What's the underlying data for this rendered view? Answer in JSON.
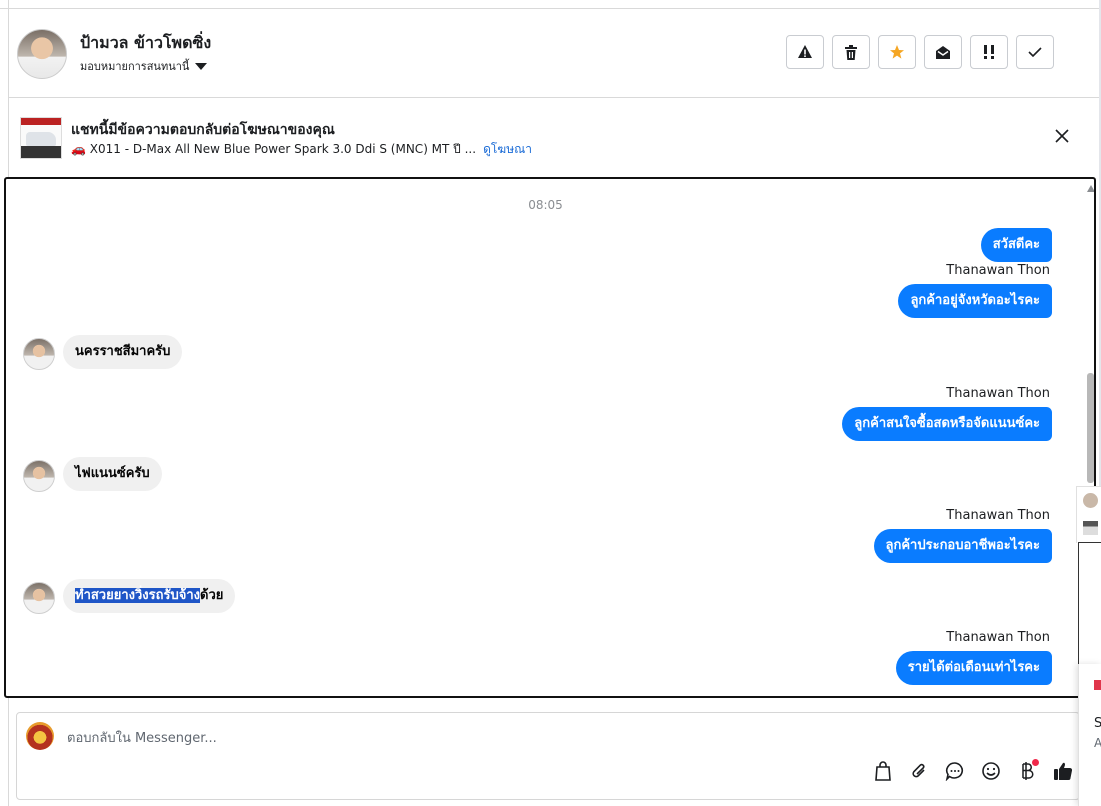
{
  "header": {
    "contact_name": "ป้ามวล ข้าวโพดซิ่ง",
    "assign_label": "มอบหมายการสนทนานี้",
    "actions": [
      "warning-icon",
      "trash-icon",
      "star-icon",
      "mark-unread-icon",
      "priority-icon",
      "done-icon"
    ],
    "star_color": "#f5a623"
  },
  "ad_banner": {
    "title": "แชทนี้มีข้อความตอบกลับต่อโฆษณาของคุณ",
    "subtitle": "🚗 X011 - D-Max All New Blue Power Spark 3.0 Ddi S (MNC) MT ปี ...",
    "link": "ดูโฆษณา"
  },
  "conversation": {
    "timestamp": "08:05",
    "messages": [
      {
        "direction": "out",
        "sender": "",
        "text": "สวัสดีคะ"
      },
      {
        "direction": "out",
        "sender": "Thanawan Thon",
        "text": "ลูกค้าอยู่จังหวัดอะไรคะ"
      },
      {
        "direction": "in",
        "text": "นครราชสีมาครับ"
      },
      {
        "direction": "out",
        "sender": "Thanawan Thon",
        "text": "ลูกค้าสนใจซื้อสดหรือจัดแนนซ์คะ"
      },
      {
        "direction": "in",
        "text": "ไฟแนนซ์ครับ"
      },
      {
        "direction": "out",
        "sender": "Thanawan Thon",
        "text": "ลูกค้าประกอบอาชีพอะไรคะ"
      },
      {
        "direction": "in",
        "text_selected": "ทำสวยยางวิ่งรถรับจ้าง",
        "text_rest": "ด้วย"
      },
      {
        "direction": "out",
        "sender": "Thanawan Thon",
        "text": "รายได้ต่อเดือนเท่าไรคะ"
      }
    ],
    "accent_color": "#0a7cff"
  },
  "composer": {
    "placeholder": "ตอบกลับใน Messenger...",
    "tools": [
      "shopping-bag-icon",
      "attachment-icon",
      "saved-reply-icon",
      "emoji-icon",
      "baht-payment-icon",
      "thumbs-up-icon"
    ]
  },
  "side_panel": {
    "text1": "S",
    "text2": "A"
  }
}
